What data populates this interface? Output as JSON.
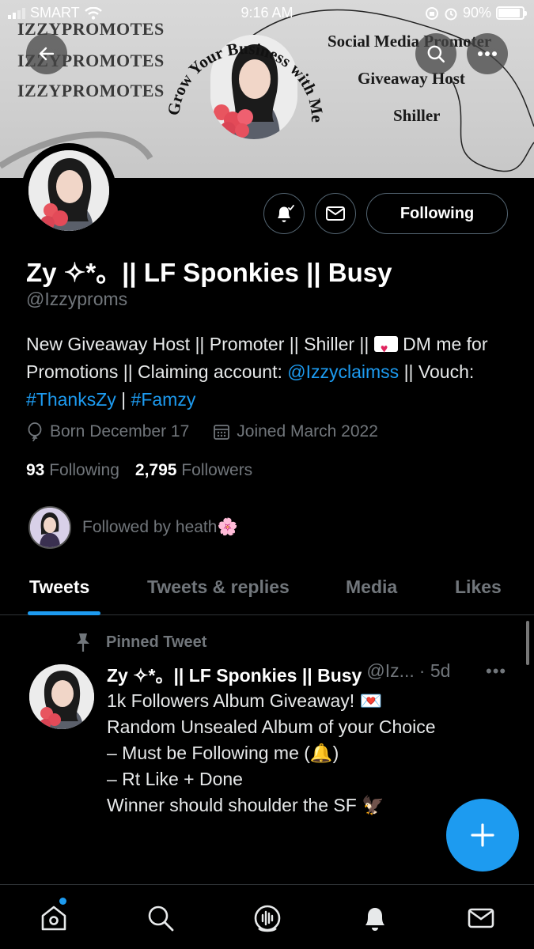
{
  "status_bar": {
    "carrier": "SMART",
    "time": "9:16 AM",
    "battery": "90%",
    "battery_level": 0.9
  },
  "banner": {
    "watermark_lines": [
      "IZZYPROMOTES",
      "IZZYPROMOTES",
      "IZZYPROMOTES"
    ],
    "arc_text": "Grow Your Business with Me",
    "roles": [
      "Social Media Promoter",
      "Giveaway Host",
      "Shiller"
    ]
  },
  "header_actions": {
    "back_icon": "back-arrow-icon",
    "search_icon": "search-icon",
    "more_icon": "more-icon"
  },
  "profile": {
    "display_name": "Zy ✧*。|| LF Sponkies || Busy",
    "handle": "@Izzyproms",
    "bio": {
      "part1": "New Giveaway Host || Promoter || Shiller || ",
      "part2": " DM me for Promotions || Claiming account: ",
      "mention": "@Izzyclaimss",
      "part3": " || Vouch: ",
      "hashtag1": "#ThanksZy",
      "separator": " | ",
      "hashtag2": "#Famzy"
    },
    "born": "Born December 17",
    "joined": "Joined March 2022",
    "following_count": "93",
    "following_label": "Following",
    "followers_count": "2,795",
    "followers_label": "Followers",
    "followed_by": "Followed by heath🌸",
    "follow_button": "Following"
  },
  "tabs": [
    {
      "label": "Tweets",
      "active": true
    },
    {
      "label": "Tweets & replies",
      "active": false
    },
    {
      "label": "Media",
      "active": false
    },
    {
      "label": "Likes",
      "active": false
    }
  ],
  "pinned_tweet": {
    "label": "Pinned Tweet",
    "author_name": "Zy ✧*。|| LF Sponkies || Busy",
    "author_handle": "@Iz...",
    "time": "· 5d",
    "more": "•••",
    "lines": [
      "1k Followers Album Giveaway! 💌",
      "",
      "Random Unsealed Album of your Choice",
      "",
      "– Must be Following me (🔔)",
      "– Rt Like + Done",
      "",
      "Winner should shoulder the SF 🦅"
    ]
  },
  "bottom_nav": [
    "home-icon",
    "search-icon",
    "spaces-icon",
    "notifications-icon",
    "messages-icon"
  ],
  "colors": {
    "accent": "#1d9bf0",
    "background": "#000000",
    "secondary_text": "#71767b"
  }
}
